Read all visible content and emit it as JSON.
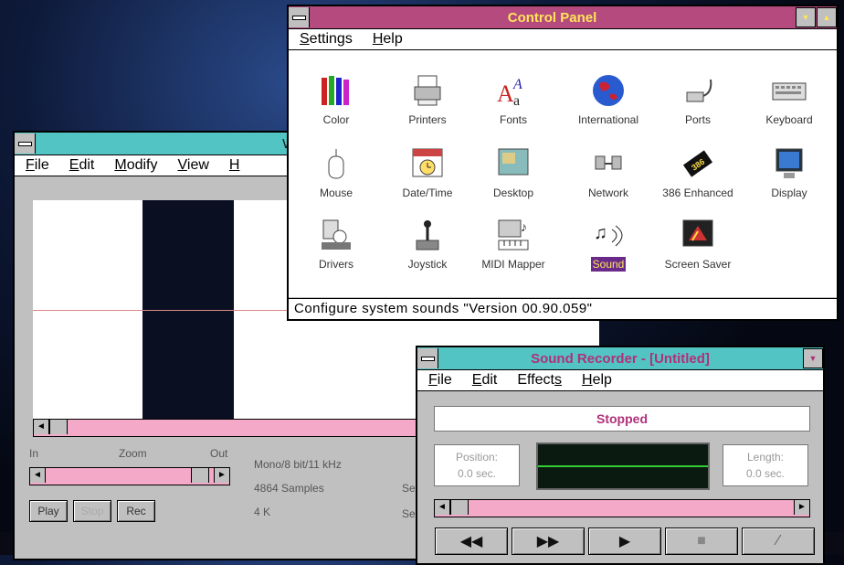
{
  "control_panel": {
    "title": "Control Panel",
    "menu": [
      {
        "accel": "S",
        "rest": "ettings"
      },
      {
        "accel": "H",
        "rest": "elp"
      }
    ],
    "items": [
      {
        "label": "Color",
        "icon": "color-icon"
      },
      {
        "label": "Printers",
        "icon": "printers-icon"
      },
      {
        "label": "Fonts",
        "icon": "fonts-icon"
      },
      {
        "label": "International",
        "icon": "international-icon"
      },
      {
        "label": "Ports",
        "icon": "ports-icon"
      },
      {
        "label": "Keyboard",
        "icon": "keyboard-icon"
      },
      {
        "label": "Mouse",
        "icon": "mouse-icon"
      },
      {
        "label": "Date/Time",
        "icon": "datetime-icon"
      },
      {
        "label": "Desktop",
        "icon": "desktop-icon"
      },
      {
        "label": "Network",
        "icon": "network-icon"
      },
      {
        "label": "386 Enhanced",
        "icon": "chip-icon"
      },
      {
        "label": "Display",
        "icon": "display-icon"
      },
      {
        "label": "Drivers",
        "icon": "drivers-icon"
      },
      {
        "label": "Joystick",
        "icon": "joystick-icon"
      },
      {
        "label": "MIDI Mapper",
        "icon": "midi-icon"
      },
      {
        "label": "Sound",
        "icon": "sound-icon",
        "selected": true
      },
      {
        "label": "Screen Saver",
        "icon": "screensaver-icon"
      }
    ],
    "status": "Configure system sounds \"Version 00.90.059\""
  },
  "waveedit": {
    "title": "WaveEdit -",
    "menu": [
      {
        "accel": "F",
        "rest": "ile"
      },
      {
        "accel": "E",
        "rest": "dit"
      },
      {
        "accel": "M",
        "rest": "odify"
      },
      {
        "accel": "V",
        "rest": "iew"
      },
      {
        "accel": "H",
        "rest": ""
      }
    ],
    "zoom_in": "In",
    "zoom_label": "Zoom",
    "zoom_out": "Out",
    "format": "Mono/8 bit/11 kHz",
    "samples": "4864 Samples",
    "size": "4 K",
    "se1": "Se",
    "se2": "Se",
    "play": "Play",
    "stop": "Stop",
    "rec": "Rec"
  },
  "sound_recorder": {
    "title": "Sound Recorder - [Untitled]",
    "menu": [
      {
        "accel": "F",
        "rest": "ile"
      },
      {
        "accel": "E",
        "rest": "dit"
      },
      {
        "accel": "s",
        "pre": "Effect",
        "rest": ""
      },
      {
        "accel": "H",
        "rest": "elp"
      }
    ],
    "status": "Stopped",
    "position_label": "Position:",
    "position_value": "0.0 sec.",
    "length_label": "Length:",
    "length_value": "0.0 sec."
  },
  "colors": {
    "cp_title_bg": "#b44a7e",
    "cp_title_fg": "#ffe55a",
    "we_title_bg": "#52c4c4",
    "sr_title_fg": "#b0307a",
    "scroll_track": "#f4a9c8"
  }
}
